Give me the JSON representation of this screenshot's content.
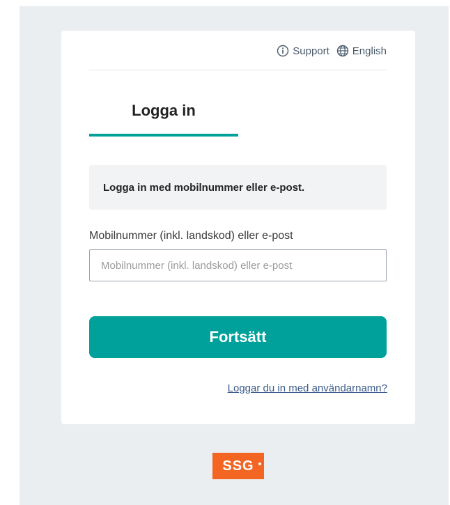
{
  "header": {
    "support_label": "Support",
    "language_label": "English",
    "support_icon": "info-circle-icon",
    "language_icon": "globe-icon"
  },
  "tabs": [
    {
      "label": "Logga in",
      "active": true
    }
  ],
  "info": {
    "message": "Logga in med mobilnummer eller e-post."
  },
  "form": {
    "field_label": "Mobilnummer (inkl. landskod) eller e-post",
    "field_placeholder": "Mobilnummer (inkl. landskod) eller e-post",
    "field_value": "",
    "submit_label": "Fortsätt"
  },
  "alt_login": {
    "link_text": "Loggar du in med användarnamn?"
  },
  "footer": {
    "logo_text": "SSG"
  },
  "colors": {
    "accent": "#00a19a",
    "background": "#ebeef1",
    "logo": "#f26522",
    "link": "#3b5b8a"
  }
}
